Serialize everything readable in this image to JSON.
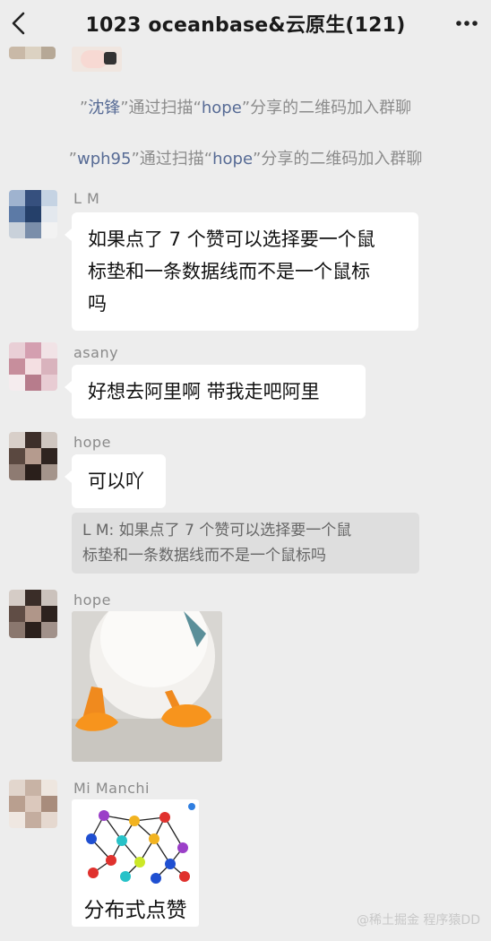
{
  "header": {
    "title": "1023 oceanbase&云原生(121)",
    "back_icon": "chevron-left-icon",
    "more_icon": "more-horizontal-icon"
  },
  "system_messages": [
    {
      "prefix": "”",
      "name": "沈锋",
      "mid": "”通过扫描“",
      "inviter": "hope",
      "suffix": "”分享的二维码加入群聊"
    },
    {
      "prefix": "”",
      "name": "wph95",
      "mid": "”通过扫描“",
      "inviter": "hope",
      "suffix": "”分享的二维码加入群聊"
    }
  ],
  "messages": [
    {
      "sender": "L M",
      "lines": [
        "如果点了 7 个赞可以选择要一个鼠",
        "标垫和一条数据线而不是一个鼠标",
        "吗"
      ]
    },
    {
      "sender": "asany",
      "lines": [
        "好想去阿里啊 带我走吧阿里"
      ]
    },
    {
      "sender": "hope",
      "lines": [
        "可以吖"
      ],
      "quote_lines": [
        "L M: 如果点了 7 个赞可以选择要一个鼠",
        "标垫和一条数据线而不是一个鼠标吗"
      ]
    },
    {
      "sender": "hope",
      "sticker": "duck-feet-sticker"
    },
    {
      "sender": "Mi Manchi",
      "sticker": "network-diagram-sticker",
      "sticker_caption": "分布式点赞"
    }
  ],
  "watermark": "@稀土掘金 程序猿DD",
  "colors": {
    "background": "#ededed",
    "bubble": "#ffffff",
    "link": "#576b95",
    "quote": "#dedede"
  }
}
